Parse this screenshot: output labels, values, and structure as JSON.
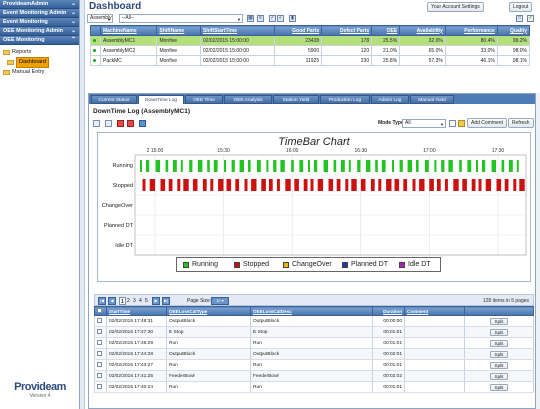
{
  "sidebar": {
    "sections": [
      {
        "label": "ProvideamAdmin"
      },
      {
        "label": "Event Monitoring Admin"
      },
      {
        "label": "Event Monitoring"
      },
      {
        "label": "OEE Monitoring Admin"
      },
      {
        "label": "OEE Monitoring"
      }
    ],
    "tree": [
      {
        "label": "Reports"
      },
      {
        "label": "Dashboard"
      },
      {
        "label": "Manual Entry"
      }
    ],
    "logo": {
      "brand": "Provideam",
      "version": "Version 4"
    }
  },
  "header": {
    "title": "Dashboard",
    "account_settings": "Your Account Settings",
    "logout": "Logout"
  },
  "toolbar": {
    "area_select": "Assembly",
    "line_select": "--All--"
  },
  "machines": {
    "columns": [
      "MachineName",
      "ShiftName",
      "ShiftStartTime",
      "Good Parts",
      "Defect Parts",
      "OEE",
      "Availability",
      "Performance",
      "Quality"
    ],
    "rows": [
      {
        "name": "AssemblyMC1",
        "shift": "Monfive",
        "start": "02/02/2015 15:00:00",
        "good": "23438",
        "defect": "178",
        "oee": "25.5%",
        "availability": "32.0%",
        "performance": "80.4%",
        "quality": "99.2%",
        "selected": true
      },
      {
        "name": "AssemblyMC2",
        "shift": "Monfive",
        "start": "02/02/2015 15:00:00",
        "good": "5900",
        "defect": "120",
        "oee": "21.0%",
        "availability": "65.0%",
        "performance": "33.0%",
        "quality": "98.0%",
        "selected": false
      },
      {
        "name": "PackMC",
        "shift": "Monfive",
        "start": "02/02/2015 15:00:00",
        "good": "11925",
        "defect": "230",
        "oee": "25.8%",
        "availability": "57.3%",
        "performance": "46.1%",
        "quality": "98.1%",
        "selected": false
      }
    ]
  },
  "tabs": [
    {
      "label": "Current Status",
      "active": false
    },
    {
      "label": "DownTime Log",
      "active": true
    },
    {
      "label": "OEE Time",
      "active": false
    },
    {
      "label": "OEE Analysis",
      "active": false
    },
    {
      "label": "Station Yield",
      "active": false
    },
    {
      "label": "Production Log",
      "active": false
    },
    {
      "label": "Admin Log",
      "active": false
    },
    {
      "label": "Manual Yield",
      "active": false
    }
  ],
  "downtime": {
    "title": "DownTime Log (AssemblyMC1)",
    "mode_label": "Mode Type",
    "mode_value": "All",
    "add_comment": "Add Comment",
    "refresh": "Refresh"
  },
  "chart_data": {
    "type": "timebar",
    "title": "TimeBar Chart",
    "x_ticks": [
      "15:00",
      "15:30",
      "16:00",
      "16:30",
      "17:00",
      "17:30"
    ],
    "x_date_prefix": "2",
    "categories": [
      "Running",
      "Stopped",
      "ChangeOver",
      "Planned DT",
      "Idle DT"
    ],
    "colors": {
      "Running": "#22c422",
      "Stopped": "#cc1111",
      "ChangeOver": "#e6b800",
      "Planned DT": "#1a3aa8",
      "Idle DT": "#b01eb0"
    },
    "legend": [
      "Running",
      "Stopped",
      "ChangeOver",
      "Planned DT",
      "Idle DT"
    ],
    "legend_position": "bottom"
  },
  "dt_grid": {
    "pages": [
      "1",
      "2",
      "3",
      "4",
      "5"
    ],
    "page_size_label": "Page Size:",
    "page_size": "10",
    "count": "128 items in 5 pages",
    "columns": [
      "",
      "StartTime",
      "OEELossCatType",
      "OEELossCatDesc",
      "Duration",
      "Comment",
      ""
    ],
    "rows": [
      {
        "start": "02/02/2015 17:48:31",
        "type": "OutputBlock",
        "desc": "OutputBlock",
        "duration": "00:00:00"
      },
      {
        "start": "02/02/2015 17:47:30",
        "type": "E Stop",
        "desc": "E Stop",
        "duration": "00:01:01"
      },
      {
        "start": "02/02/2015 17:46:29",
        "type": "Run",
        "desc": "Run",
        "duration": "00:01:01"
      },
      {
        "start": "02/02/2015 17:44:28",
        "type": "OutputBlock",
        "desc": "OutputBlock",
        "duration": "00:02:01"
      },
      {
        "start": "02/02/2015 17:43:27",
        "type": "Run",
        "desc": "Run",
        "duration": "00:01:01"
      },
      {
        "start": "02/02/2015 17:41:25",
        "type": "FeederBowl",
        "desc": "FeederBowl",
        "duration": "00:02:02"
      },
      {
        "start": "02/02/2015 17:40:24",
        "type": "Run",
        "desc": "Run",
        "duration": "00:01:01"
      }
    ],
    "split_label": "Split"
  }
}
